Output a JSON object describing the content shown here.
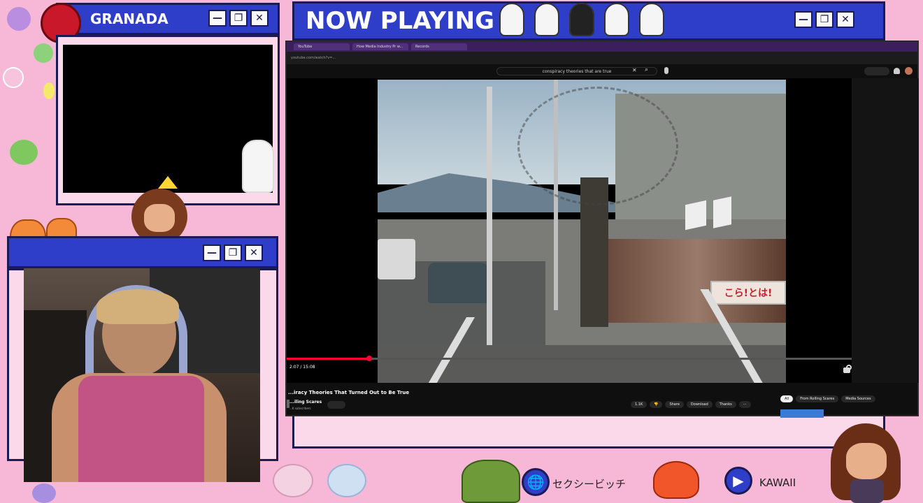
{
  "overlay": {
    "granada_title": "GRANADA",
    "now_playing_title": "NOW PLAYING",
    "window_buttons": {
      "minimize": "—",
      "maximize": "❐",
      "close": "✕"
    },
    "bottom_links": [
      {
        "label": "セクシービッチ",
        "icon": "globe-icon",
        "glyph": "🌐"
      },
      {
        "label": "KAWAII",
        "icon": "play-icon",
        "glyph": "▶"
      }
    ]
  },
  "browser": {
    "tabs": [
      "YouTube",
      "How Media Industry Pr w...",
      "Records"
    ],
    "address": "youtube.com/watch?v=...",
    "search_query": "conspiracy theories that are true",
    "time_display": "2:07 / 15:08",
    "video_title": "...iracy Theories That Turned Out to Be True",
    "channel_name": "...iling Scares",
    "subscribers": "...K subscribers",
    "actions": [
      "1.1K",
      "Share",
      "Download",
      "Thanks"
    ],
    "related_chips": [
      "All",
      "From Rolling Scares",
      "Media Sources"
    ],
    "protest_sign": "こら!とは!"
  },
  "colors": {
    "bg_pink": "#f6b8d6",
    "title_blue": "#2f3ec9",
    "border_navy": "#1a1a55",
    "yt_red": "#ff0033"
  }
}
